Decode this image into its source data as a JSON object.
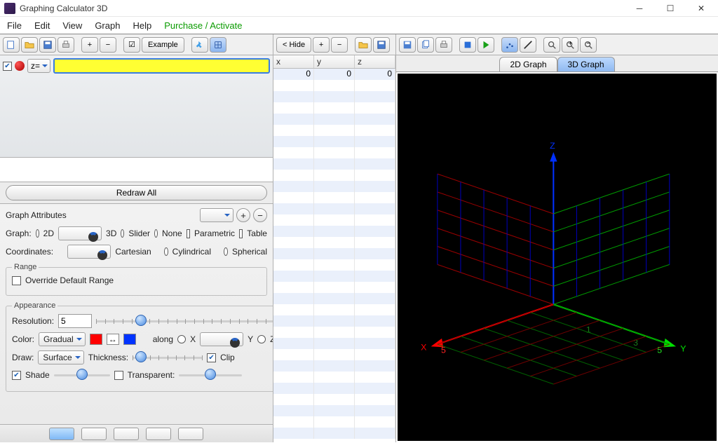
{
  "window": {
    "title": "Graphing Calculator 3D"
  },
  "menubar": {
    "file": "File",
    "edit": "Edit",
    "view": "View",
    "graph": "Graph",
    "help": "Help",
    "purchase": "Purchase / Activate"
  },
  "left_toolbar": {
    "example": "Example"
  },
  "mid_toolbar": {
    "hide": "< Hide"
  },
  "fx": {
    "z_label": "z=",
    "value": ""
  },
  "redraw_label": "Redraw All",
  "attrs": {
    "title": "Graph Attributes",
    "graph_label": "Graph:",
    "opt_2d": "2D",
    "opt_3d": "3D",
    "opt_slider": "Slider",
    "opt_none": "None",
    "opt_param": "Parametric",
    "opt_table": "Table",
    "coords_label": "Coordinates:",
    "coord_cart": "Cartesian",
    "coord_cyl": "Cylindrical",
    "coord_sph": "Spherical",
    "range_legend": "Range",
    "override": "Override Default Range",
    "appearance_legend": "Appearance",
    "resolution_label": "Resolution:",
    "resolution_value": "5",
    "color_label": "Color:",
    "color_mode": "Gradual",
    "along_label": "along",
    "axis_x": "X",
    "axis_y": "Y",
    "axis_z": "Z",
    "draw_label": "Draw:",
    "draw_mode": "Surface",
    "thickness_label": "Thickness:",
    "clip_label": "Clip",
    "shade_label": "Shade",
    "transparent_label": "Transparent:"
  },
  "table": {
    "cols": [
      "x",
      "y",
      "z"
    ],
    "row0": [
      "0",
      "0",
      "0"
    ]
  },
  "tabs": {
    "two": "2D Graph",
    "three": "3D Graph"
  },
  "axes": {
    "x": "X",
    "y": "Y",
    "z": "Z"
  }
}
